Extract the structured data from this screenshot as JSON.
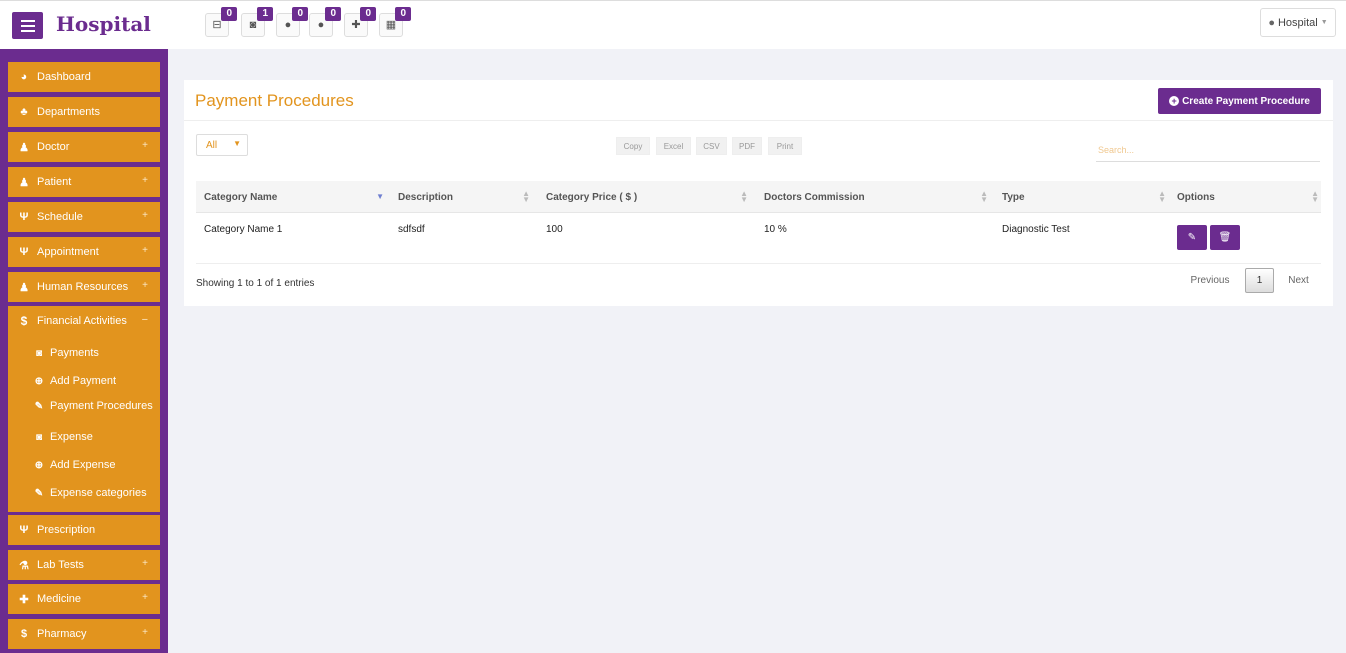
{
  "header": {
    "brand": "Hospital",
    "notifications": [
      {
        "icon": "bed-icon",
        "glyph": "⊟",
        "count": "0"
      },
      {
        "icon": "money-icon",
        "glyph": "◙",
        "count": "1"
      },
      {
        "icon": "user-icon",
        "glyph": "●",
        "count": "0"
      },
      {
        "icon": "user-md-icon",
        "glyph": "●",
        "count": "0"
      },
      {
        "icon": "medkit-icon",
        "glyph": "✚",
        "count": "0"
      },
      {
        "icon": "hospital-icon",
        "glyph": "▦",
        "count": "0"
      }
    ],
    "user_label": "Hospital"
  },
  "sidebar": {
    "items": [
      {
        "label": "Dashboard",
        "icon": "dashboard-icon",
        "glyph": "◕"
      },
      {
        "label": "Departments",
        "icon": "sitemap-icon",
        "glyph": "♣"
      },
      {
        "label": "Doctor",
        "icon": "users-icon",
        "glyph": "♟",
        "plus": "+"
      },
      {
        "label": "Patient",
        "icon": "users-icon",
        "glyph": "♟",
        "plus": "+"
      },
      {
        "label": "Schedule",
        "icon": "stethoscope-icon",
        "glyph": "Ψ",
        "plus": "+"
      },
      {
        "label": "Appointment",
        "icon": "stethoscope-icon",
        "glyph": "Ψ",
        "plus": "+"
      },
      {
        "label": "Human Resources",
        "icon": "users-icon",
        "glyph": "♟",
        "plus": "+"
      }
    ],
    "financial": {
      "label": "Financial Activities",
      "icon": "dollar-icon",
      "glyph": "$",
      "toggle": "−",
      "sub_items": [
        {
          "label": "Payments",
          "icon": "money-icon",
          "glyph": "◙"
        },
        {
          "label": "Add Payment",
          "icon": "plus-circle-icon",
          "glyph": "⊕"
        },
        {
          "label": "Payment Procedures",
          "icon": "edit-icon",
          "glyph": "✎"
        },
        {
          "label": "Expense",
          "icon": "money-icon",
          "glyph": "◙"
        },
        {
          "label": "Add Expense",
          "icon": "plus-circle-icon",
          "glyph": "⊕"
        },
        {
          "label": "Expense categories",
          "icon": "edit-icon",
          "glyph": "✎"
        }
      ]
    },
    "items_after": [
      {
        "label": "Prescription",
        "icon": "stethoscope-icon",
        "glyph": "Ψ"
      },
      {
        "label": "Lab Tests",
        "icon": "flask-icon",
        "glyph": "⚗",
        "plus": "+"
      },
      {
        "label": "Medicine",
        "icon": "medkit-icon",
        "glyph": "✚",
        "plus": "+"
      },
      {
        "label": "Pharmacy",
        "icon": "dollar-icon",
        "glyph": "$",
        "plus": "+"
      }
    ]
  },
  "main": {
    "title": "Payment Procedures",
    "create_button": "Create Payment Procedure",
    "length_select": "All",
    "export_buttons": [
      "Copy",
      "Excel",
      "CSV",
      "PDF",
      "Print"
    ],
    "search_placeholder": "Search...",
    "table": {
      "columns": [
        "Category Name",
        "Description",
        "Category Price ( $ )",
        "Doctors Commission",
        "Type",
        "Options"
      ],
      "rows": [
        {
          "category_name": "Category Name 1",
          "description": "sdfsdf",
          "price": "100",
          "commission": "10 %",
          "type": "Diagnostic Test"
        }
      ]
    },
    "info": "Showing 1 to 1 of 1 entries",
    "pagination": {
      "previous": "Previous",
      "current": "1",
      "next": "Next"
    }
  },
  "colors": {
    "brand_purple": "#6b2c8f",
    "accent_orange": "#e2941e",
    "background": "#f1f2f7"
  }
}
